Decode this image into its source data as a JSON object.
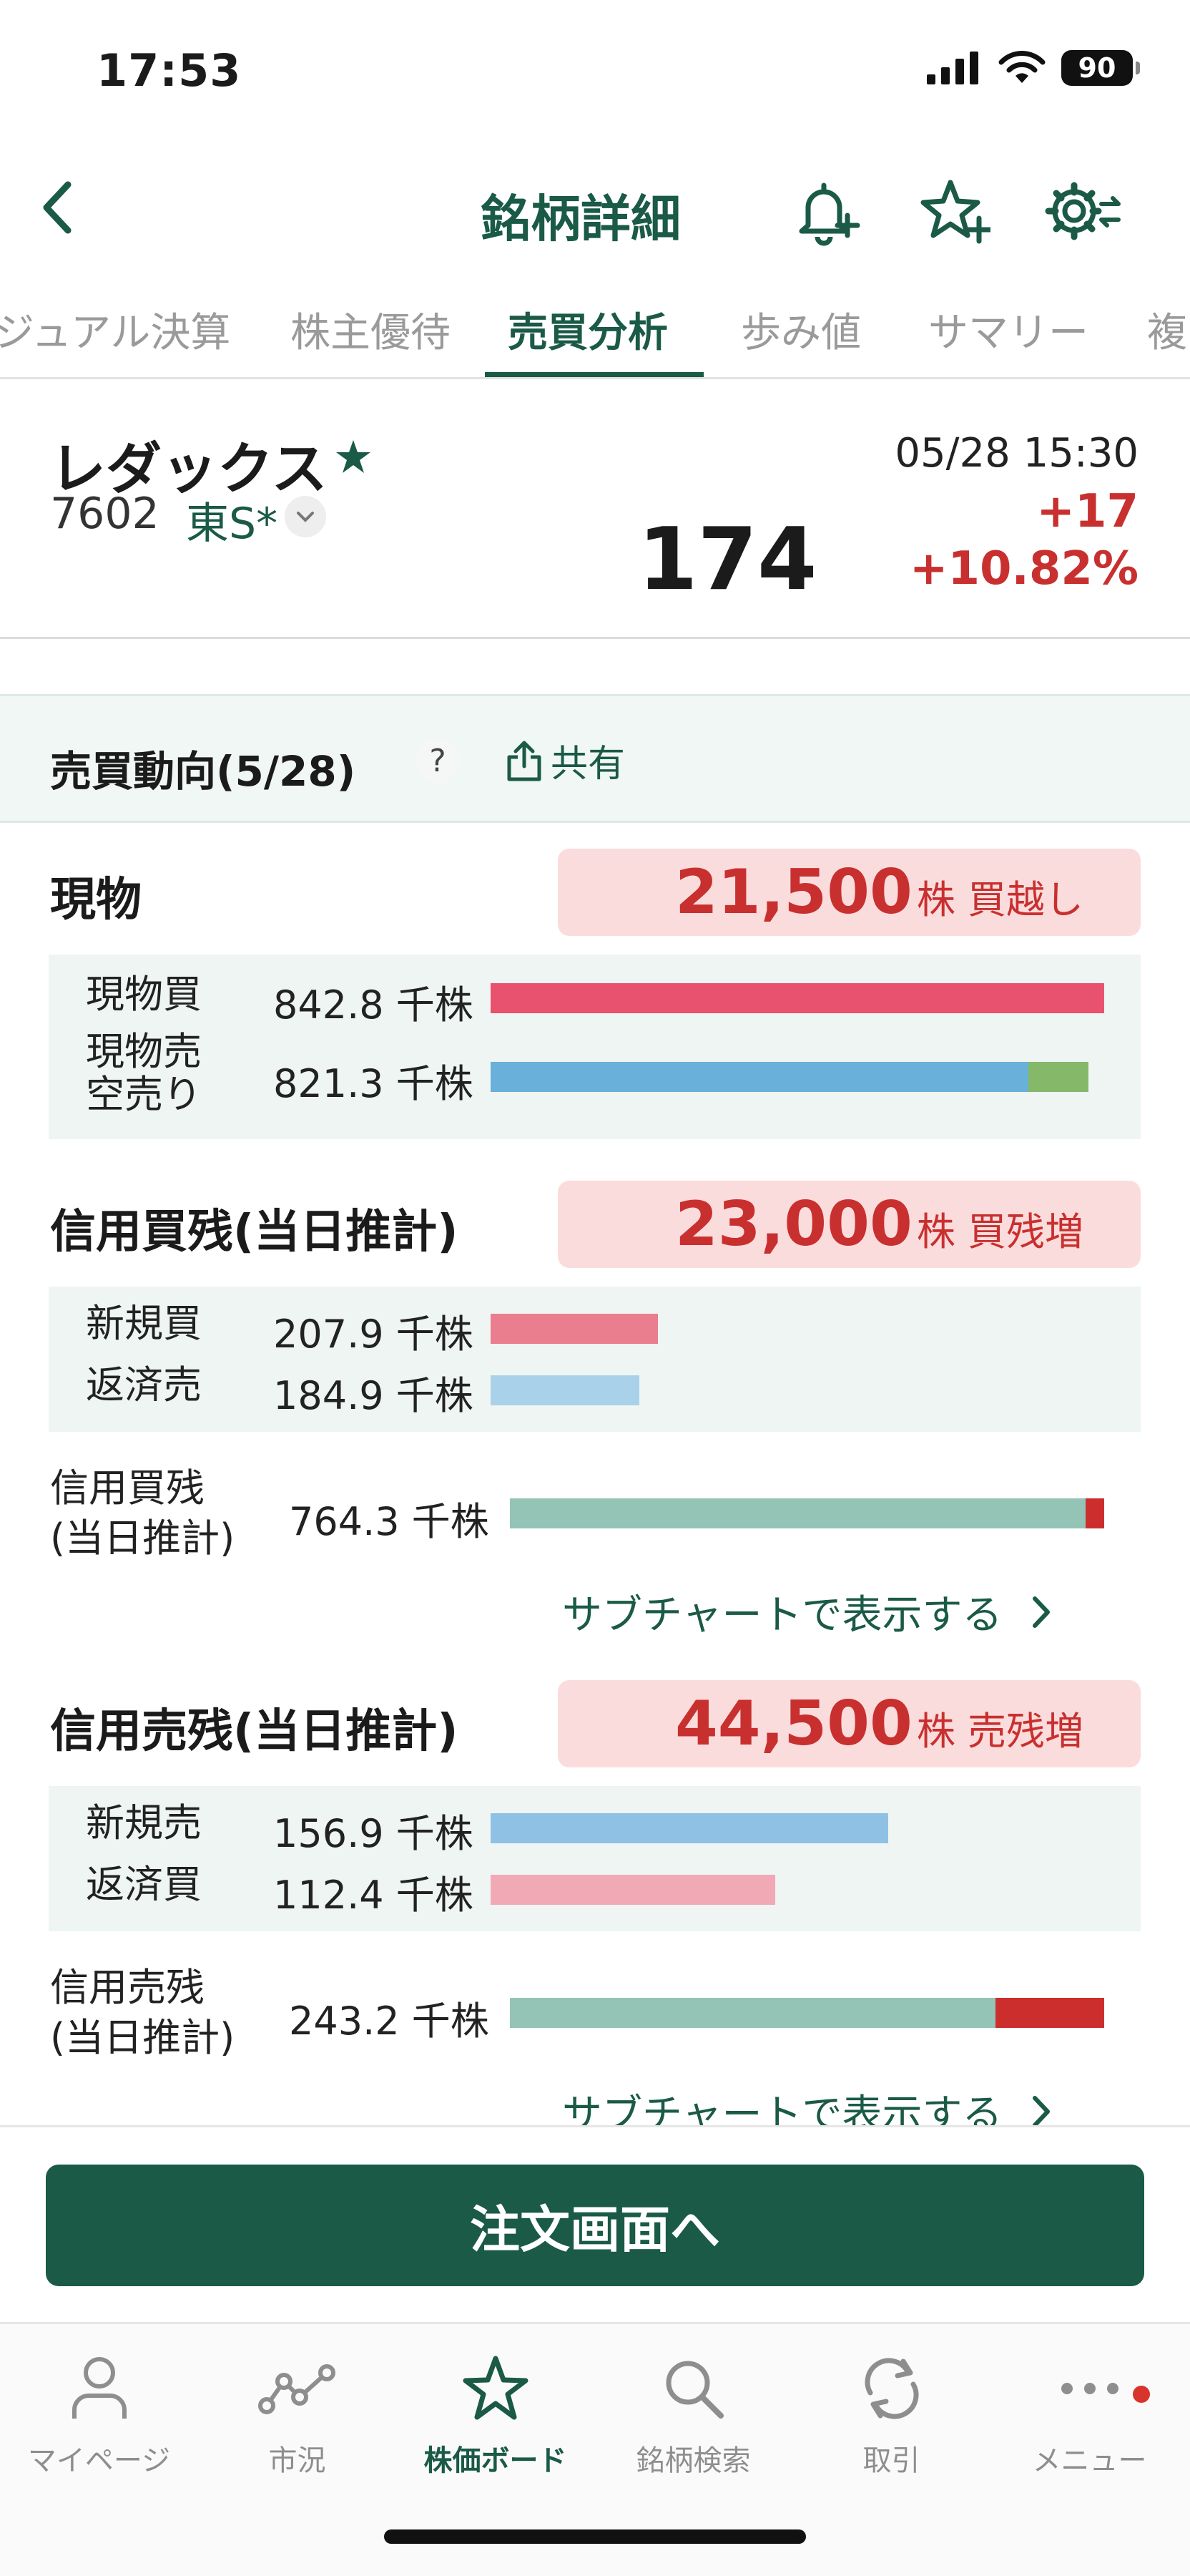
{
  "status": {
    "time": "17:53",
    "battery": "90"
  },
  "header": {
    "title": "銘柄詳細"
  },
  "tabs": [
    {
      "label": "ジュアル決算"
    },
    {
      "label": "株主優待"
    },
    {
      "label": "売買分析"
    },
    {
      "label": "歩み値"
    },
    {
      "label": "サマリー"
    },
    {
      "label": "複"
    }
  ],
  "stock": {
    "name": "レダックス",
    "code": "7602",
    "market": "東S*",
    "price": "174",
    "datetime": "05/28 15:30",
    "change": "+17",
    "change_pct": "+10.82%"
  },
  "section": {
    "title": "売買動向(5/28)",
    "help": "?",
    "share": "共有"
  },
  "genbutsu": {
    "title": "現物",
    "badge_value": "21,500",
    "badge_unit": "株 買越し",
    "rows": [
      {
        "label": "現物買",
        "value": "842.8 千株"
      },
      {
        "label1": "現物売",
        "label2": "空売り",
        "value": "821.3 千株"
      }
    ]
  },
  "margin_buy": {
    "title": "信用買残(当日推計)",
    "badge_value": "23,000",
    "badge_unit": "株 買残増",
    "rows": [
      {
        "label": "新規買",
        "value": "207.9 千株"
      },
      {
        "label": "返済売",
        "value": "184.9 千株"
      }
    ],
    "total_label1": "信用買残",
    "total_label2": "(当日推計)",
    "total_value": "764.3 千株",
    "link": "サブチャートで表示する"
  },
  "margin_sell": {
    "title": "信用売残(当日推計)",
    "badge_value": "44,500",
    "badge_unit": "株 売残増",
    "rows": [
      {
        "label": "新規売",
        "value": "156.9 千株"
      },
      {
        "label": "返済買",
        "value": "112.4 千株"
      }
    ],
    "total_label1": "信用売残",
    "total_label2": "(当日推計)",
    "total_value": "243.2 千株",
    "link": "サブチャートで表示する"
  },
  "order_button": "注文画面へ",
  "nav": [
    {
      "label": "マイページ",
      "icon": "person-icon"
    },
    {
      "label": "市況",
      "icon": "market-line-icon"
    },
    {
      "label": "株価ボード",
      "icon": "star-icon"
    },
    {
      "label": "銘柄検索",
      "icon": "search-icon"
    },
    {
      "label": "取引",
      "icon": "refresh-icon"
    },
    {
      "label": "メニュー",
      "icon": "more-icon"
    }
  ],
  "colors": {
    "brand": "#1a5a47",
    "up": "#c8302f",
    "buy_bar": "#e8526f",
    "sell_bar": "#69b0da",
    "short_bar": "#86b86a",
    "margin_new_buy": "#ea7d8e",
    "margin_close_sell": "#a9d2ea",
    "margin_total": "#93c4b5",
    "margin_increase": "#cc2e2e"
  }
}
